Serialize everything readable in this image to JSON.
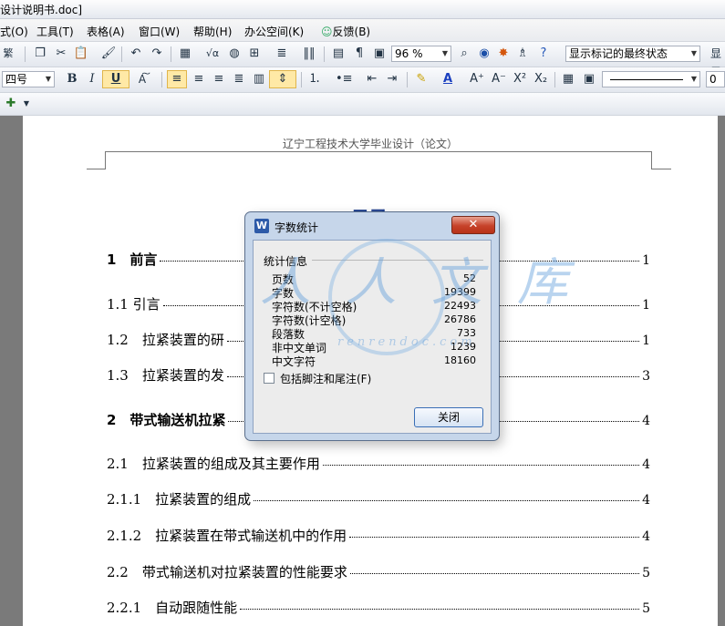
{
  "window": {
    "title": "设计说明书.doc]"
  },
  "menu": [
    "式(O)",
    "工具(T)",
    "表格(A)",
    "窗口(W)",
    "帮助(H)",
    "办公空间(K)",
    "反馈(B)"
  ],
  "toolbar": {
    "zoom": "96 %",
    "view_mode": "显示标记的最终状态",
    "show_label": "显示",
    "font_size": "四号",
    "bold": "B",
    "italic": "I",
    "underline": "U",
    "font_grow": "A⁺",
    "font_shrink": "A⁻",
    "superscript": "X²",
    "subscript": "X₂",
    "right_number": "0"
  },
  "document": {
    "header": "辽宁工程技术大学毕业设计（论文）",
    "toc_title": "目录",
    "toc": [
      {
        "text": "1　前言",
        "page": "1",
        "heading": true
      },
      {
        "text": "1.1 引言",
        "page": "1",
        "heading": false
      },
      {
        "text": "1.2　拉紧装置的研",
        "page": "1",
        "heading": false
      },
      {
        "text": "1.3　拉紧装置的发",
        "page": "3",
        "heading": false
      },
      {
        "text": "2　带式输送机拉紧",
        "page": "4",
        "heading": true
      },
      {
        "text": "2.1　拉紧装置的组成及其主要作用",
        "page": "4",
        "heading": false
      },
      {
        "text": "2.1.1　拉紧装置的组成",
        "page": "4",
        "heading": false
      },
      {
        "text": "2.1.2　拉紧装置在带式输送机中的作用",
        "page": "4",
        "heading": false
      },
      {
        "text": "2.2　带式输送机对拉紧装置的性能要求",
        "page": "5",
        "heading": false
      },
      {
        "text": "2.2.1　自动跟随性能",
        "page": "5",
        "heading": false
      }
    ]
  },
  "dialog": {
    "title": "字数统计",
    "icon_letter": "W",
    "close_symbol": "✕",
    "section": "统计信息",
    "stats": [
      {
        "label": "页数",
        "value": "52"
      },
      {
        "label": "字数",
        "value": "19399"
      },
      {
        "label": "字符数(不计空格)",
        "value": "22493"
      },
      {
        "label": "字符数(计空格)",
        "value": "26786"
      },
      {
        "label": "段落数",
        "value": "733"
      },
      {
        "label": "非中文单词",
        "value": "1239"
      },
      {
        "label": "中文字符",
        "value": "18160"
      }
    ],
    "checkbox_label": "包括脚注和尾注(F)",
    "checkbox_checked": false,
    "close_button": "关闭"
  },
  "watermark": {
    "text1": "人人文库",
    "text2": "renrendoc.com"
  }
}
